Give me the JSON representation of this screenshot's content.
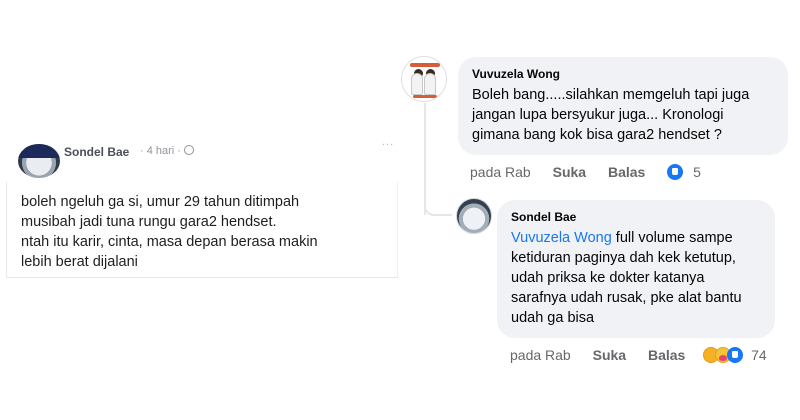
{
  "post": {
    "author": "Sondel Bae",
    "meta": "· 4 hari ·",
    "text": "boleh ngeluh ga si, umur 29 tahun ditimpah\nmusibah jadi tuna rungu gara2 hendset.\nntah itu karir, cinta, masa depan berasa makin\nlebih berat dijalani",
    "globe_icon": "globe-icon"
  },
  "comments": [
    {
      "author": "Vuvuzela Wong",
      "text": "Boleh bang.....silahkan memgeluh tapi juga\njangan lupa bersyukur juga... Kronologi\ngimana bang kok bisa gara2 hendset ?",
      "time": "pada Rab",
      "like_label": "Suka",
      "reply_label": "Balas",
      "reaction_count": "5",
      "reactions": [
        "like-icon"
      ]
    },
    {
      "author": "Sondel Bae",
      "mention": "Vuvuzela Wong",
      "text": " full volume sampe\nketiduran paginya dah kek ketutup,\nudah priksa ke dokter katanya\nsarafnya udah rusak, pke alat bantu\nudah ga bisa",
      "time": "pada Rab",
      "like_label": "Suka",
      "reply_label": "Balas",
      "reaction_count": "74",
      "reactions": [
        "haha-icon",
        "care-icon",
        "like-icon"
      ]
    }
  ],
  "colors": {
    "bubble": "#f0f2f5",
    "mention": "#1877f2",
    "muted": "#65676b",
    "like": "#1877f2"
  }
}
